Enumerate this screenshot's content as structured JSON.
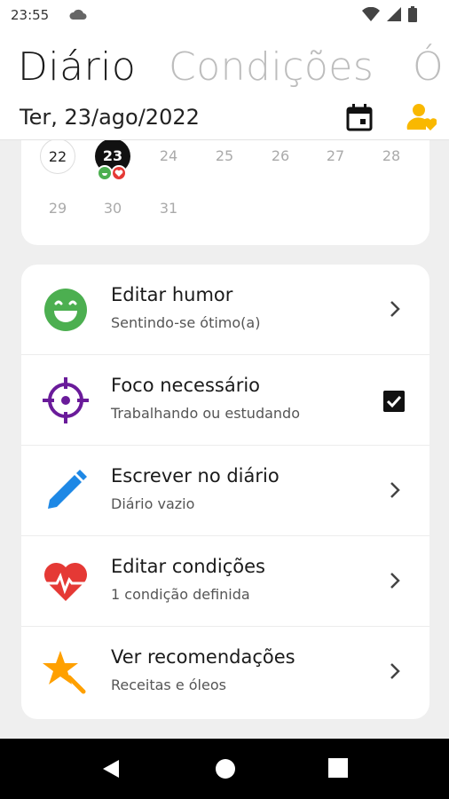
{
  "status_bar": {
    "time": "23:55"
  },
  "tabs": [
    {
      "label": "Diário"
    },
    {
      "label": "Condições"
    },
    {
      "label": "Ó"
    }
  ],
  "date_header": {
    "date": "Ter, 23/ago/2022"
  },
  "calendar": {
    "days": [
      "22",
      "23",
      "24",
      "25",
      "26",
      "27",
      "28",
      "29",
      "30",
      "31"
    ],
    "selected_day": "23"
  },
  "menu": [
    {
      "title": "Editar humor",
      "subtitle": "Sentindo-se ótimo(a)",
      "icon": "happy-face-icon",
      "color": "#4caf50"
    },
    {
      "title": "Foco necessário",
      "subtitle": "Trabalhando ou estudando",
      "icon": "crosshair-icon",
      "color": "#6a1b9a",
      "checked": true
    },
    {
      "title": "Escrever no diário",
      "subtitle": "Diário vazio",
      "icon": "pencil-icon",
      "color": "#1e88e5"
    },
    {
      "title": "Editar condições",
      "subtitle": "1 condição definida",
      "icon": "heart-pulse-icon",
      "color": "#e53935"
    },
    {
      "title": "Ver recomendações",
      "subtitle": "Receitas e óleos",
      "icon": "star-wand-icon",
      "color": "#ffa000"
    }
  ],
  "colors": {
    "accent_user": "#f9b800",
    "nav_bar": "#000000"
  }
}
